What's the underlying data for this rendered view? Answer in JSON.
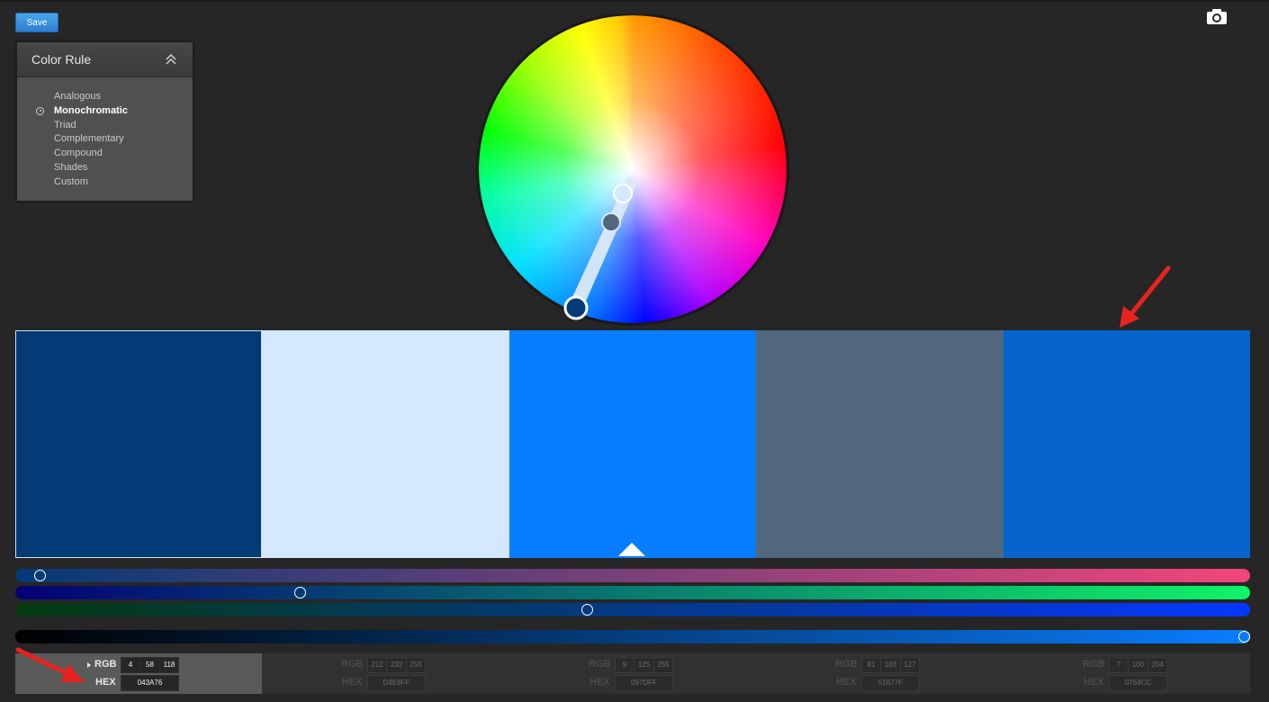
{
  "toolbar": {
    "save_label": "Save",
    "camera_icon": "camera-icon"
  },
  "color_rule": {
    "title": "Color Rule",
    "selected": "Monochromatic",
    "options": [
      "Analogous",
      "Monochromatic",
      "Triad",
      "Complementary",
      "Compound",
      "Shades",
      "Custom"
    ]
  },
  "swatches": [
    {
      "hex": "043A76",
      "rgb": [
        "4",
        "58",
        "118"
      ],
      "color": "#043A76",
      "selected": true
    },
    {
      "hex": "D4E8FF",
      "rgb": [
        "212",
        "232",
        "255"
      ],
      "color": "#D4E8FF",
      "selected": false
    },
    {
      "hex": "097DFF",
      "rgb": [
        "9",
        "125",
        "255"
      ],
      "color": "#097DFF",
      "selected": false
    },
    {
      "hex": "51677F",
      "rgb": [
        "81",
        "103",
        "127"
      ],
      "color": "#51677F",
      "selected": false
    },
    {
      "hex": "0764CC",
      "rgb": [
        "7",
        "100",
        "204"
      ],
      "color": "#0764CC",
      "selected": false
    }
  ],
  "labels": {
    "rgb": "RGB",
    "hex": "HEX"
  },
  "sliders": {
    "red": 0.016,
    "green": 0.227,
    "blue": 0.463,
    "brightness": 1.0
  },
  "annotations": {
    "arrow_color": "#e8231f"
  }
}
